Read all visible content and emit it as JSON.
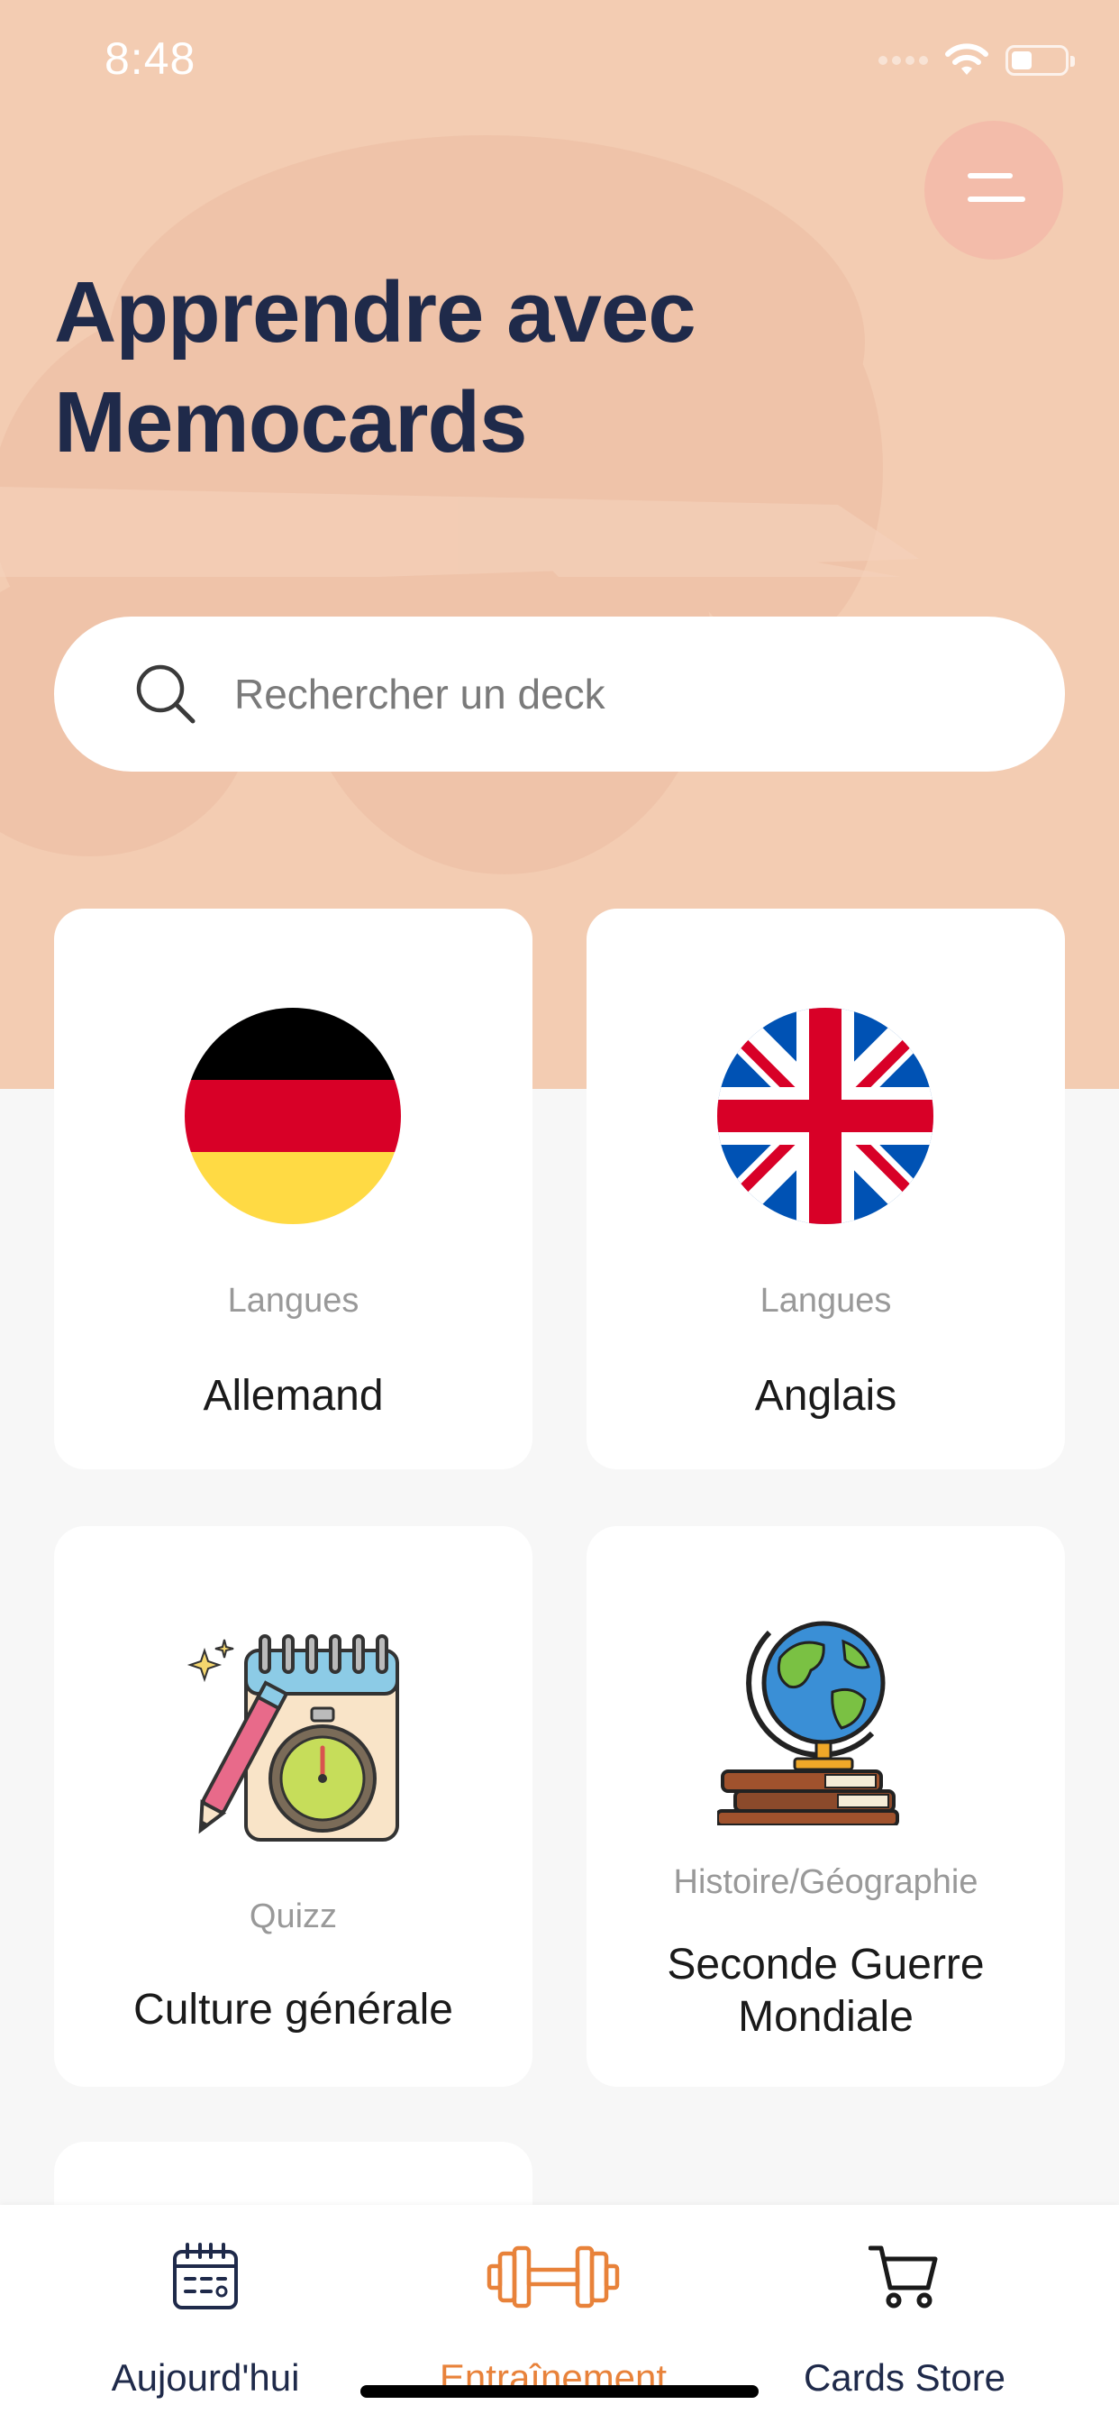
{
  "status_bar": {
    "time": "8:48"
  },
  "header": {
    "title": "Apprendre avec Memocards",
    "menu_icon": "hamburger-icon"
  },
  "search": {
    "placeholder": "Rechercher un deck",
    "value": "",
    "icon": "search-icon"
  },
  "decks": [
    {
      "category": "Langues",
      "title": "Allemand",
      "icon": "germany-flag-icon"
    },
    {
      "category": "Langues",
      "title": "Anglais",
      "icon": "uk-flag-icon"
    },
    {
      "category": "Quizz",
      "title": "Culture générale",
      "icon": "notepad-stopwatch-icon"
    },
    {
      "category": "Histoire/Géographie",
      "title": "Seconde Guerre Mondiale",
      "icon": "globe-books-icon"
    }
  ],
  "tab_bar": {
    "tabs": [
      {
        "label": "Aujourd'hui",
        "icon": "calendar-icon",
        "active": false
      },
      {
        "label": "Entraînement",
        "icon": "dumbbell-icon",
        "active": true
      },
      {
        "label": "Cards Store",
        "icon": "cart-icon",
        "active": false
      }
    ]
  },
  "colors": {
    "hero_background": "#f3ccb2",
    "title": "#1f2a4a",
    "accent": "#e8823a",
    "page_background": "#f7f7f7"
  }
}
